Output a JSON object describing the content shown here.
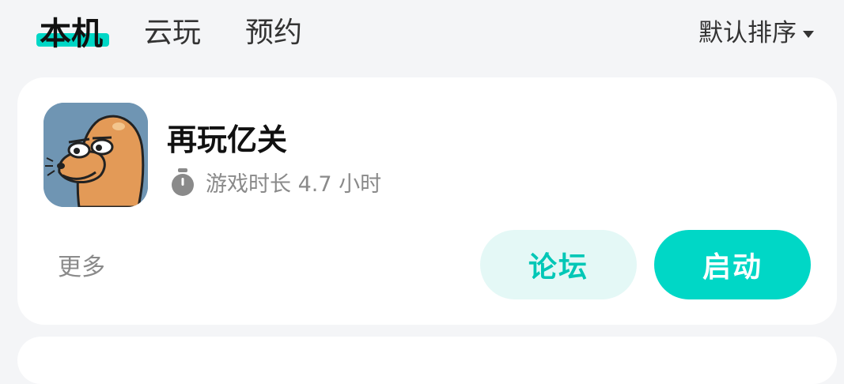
{
  "tabs": [
    {
      "label": "本机",
      "active": true
    },
    {
      "label": "云玩",
      "active": false
    },
    {
      "label": "预约",
      "active": false
    }
  ],
  "sort": {
    "label": "默认排序"
  },
  "game": {
    "title": "再玩亿关",
    "playtime": "游戏时长 4.7 小时",
    "icon": "seal-mascot-icon"
  },
  "actions": {
    "more": "更多",
    "forum": "论坛",
    "start": "启动"
  },
  "colors": {
    "accent": "#00d7c6",
    "accent_light": "#e4f8f6",
    "background": "#f4f5f7"
  }
}
